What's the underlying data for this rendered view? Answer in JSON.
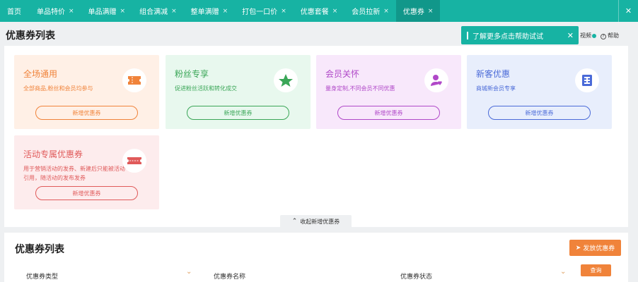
{
  "tabs": [
    {
      "label": "首页",
      "closable": false,
      "active": false
    },
    {
      "label": "单品特价",
      "closable": true,
      "active": false
    },
    {
      "label": "单品满赠",
      "closable": true,
      "active": false
    },
    {
      "label": "组合满减",
      "closable": true,
      "active": false
    },
    {
      "label": "整单满赠",
      "closable": true,
      "active": false
    },
    {
      "label": "打包一口价",
      "closable": true,
      "active": false
    },
    {
      "label": "优惠套餐",
      "closable": true,
      "active": false
    },
    {
      "label": "会员拉新",
      "closable": true,
      "active": false
    },
    {
      "label": "优惠券",
      "closable": true,
      "active": true
    }
  ],
  "tab_close_glyph": "×",
  "close_all_glyph": "✕",
  "header": {
    "title": "优惠券列表",
    "video_label": "视频",
    "help_label": "帮助"
  },
  "toast": {
    "text": "了解更多点击帮助试试",
    "close_glyph": "✕"
  },
  "templates": [
    {
      "title": "全场通用",
      "desc": "全部商品,粉丝和会员均参与",
      "button": "新增优惠券",
      "icon": "ticket-icon",
      "bg": "#fff0e6",
      "color": "#f0833a"
    },
    {
      "title": "粉丝专享",
      "desc": "促进粉丝活跃和转化成交",
      "button": "新增优惠券",
      "icon": "star-icon",
      "bg": "#e8f8ee",
      "color": "#3aa657"
    },
    {
      "title": "会员关怀",
      "desc": "量身定制,不同会员不同优惠",
      "button": "新增优惠券",
      "icon": "member-icon",
      "bg": "#f8e8fb",
      "color": "#b048c8"
    },
    {
      "title": "新客优惠",
      "desc": "商城新会员专享",
      "button": "新增优惠券",
      "icon": "new-customer-icon",
      "bg": "#e8eefc",
      "color": "#4a6ad8"
    },
    {
      "title": "活动专属优惠券",
      "desc": "用于营销活动的发券、新建后只能被活动引用，随活动的发布发券",
      "button": "新增优惠券",
      "icon": "coupon-icon",
      "bg": "#fdeced",
      "color": "#e05a5a"
    }
  ],
  "collapse_label": "收起新增优惠券",
  "list": {
    "title": "优惠券列表",
    "issue_button": "发放优惠券",
    "filters": [
      {
        "label": "优惠券类型"
      },
      {
        "label": "优惠券名称"
      },
      {
        "label": "优惠券状态"
      }
    ],
    "query_button": "查询"
  },
  "colors": {
    "accent": "#17b3a3",
    "accent_dark": "#11978a",
    "orange": "#f0833a"
  }
}
